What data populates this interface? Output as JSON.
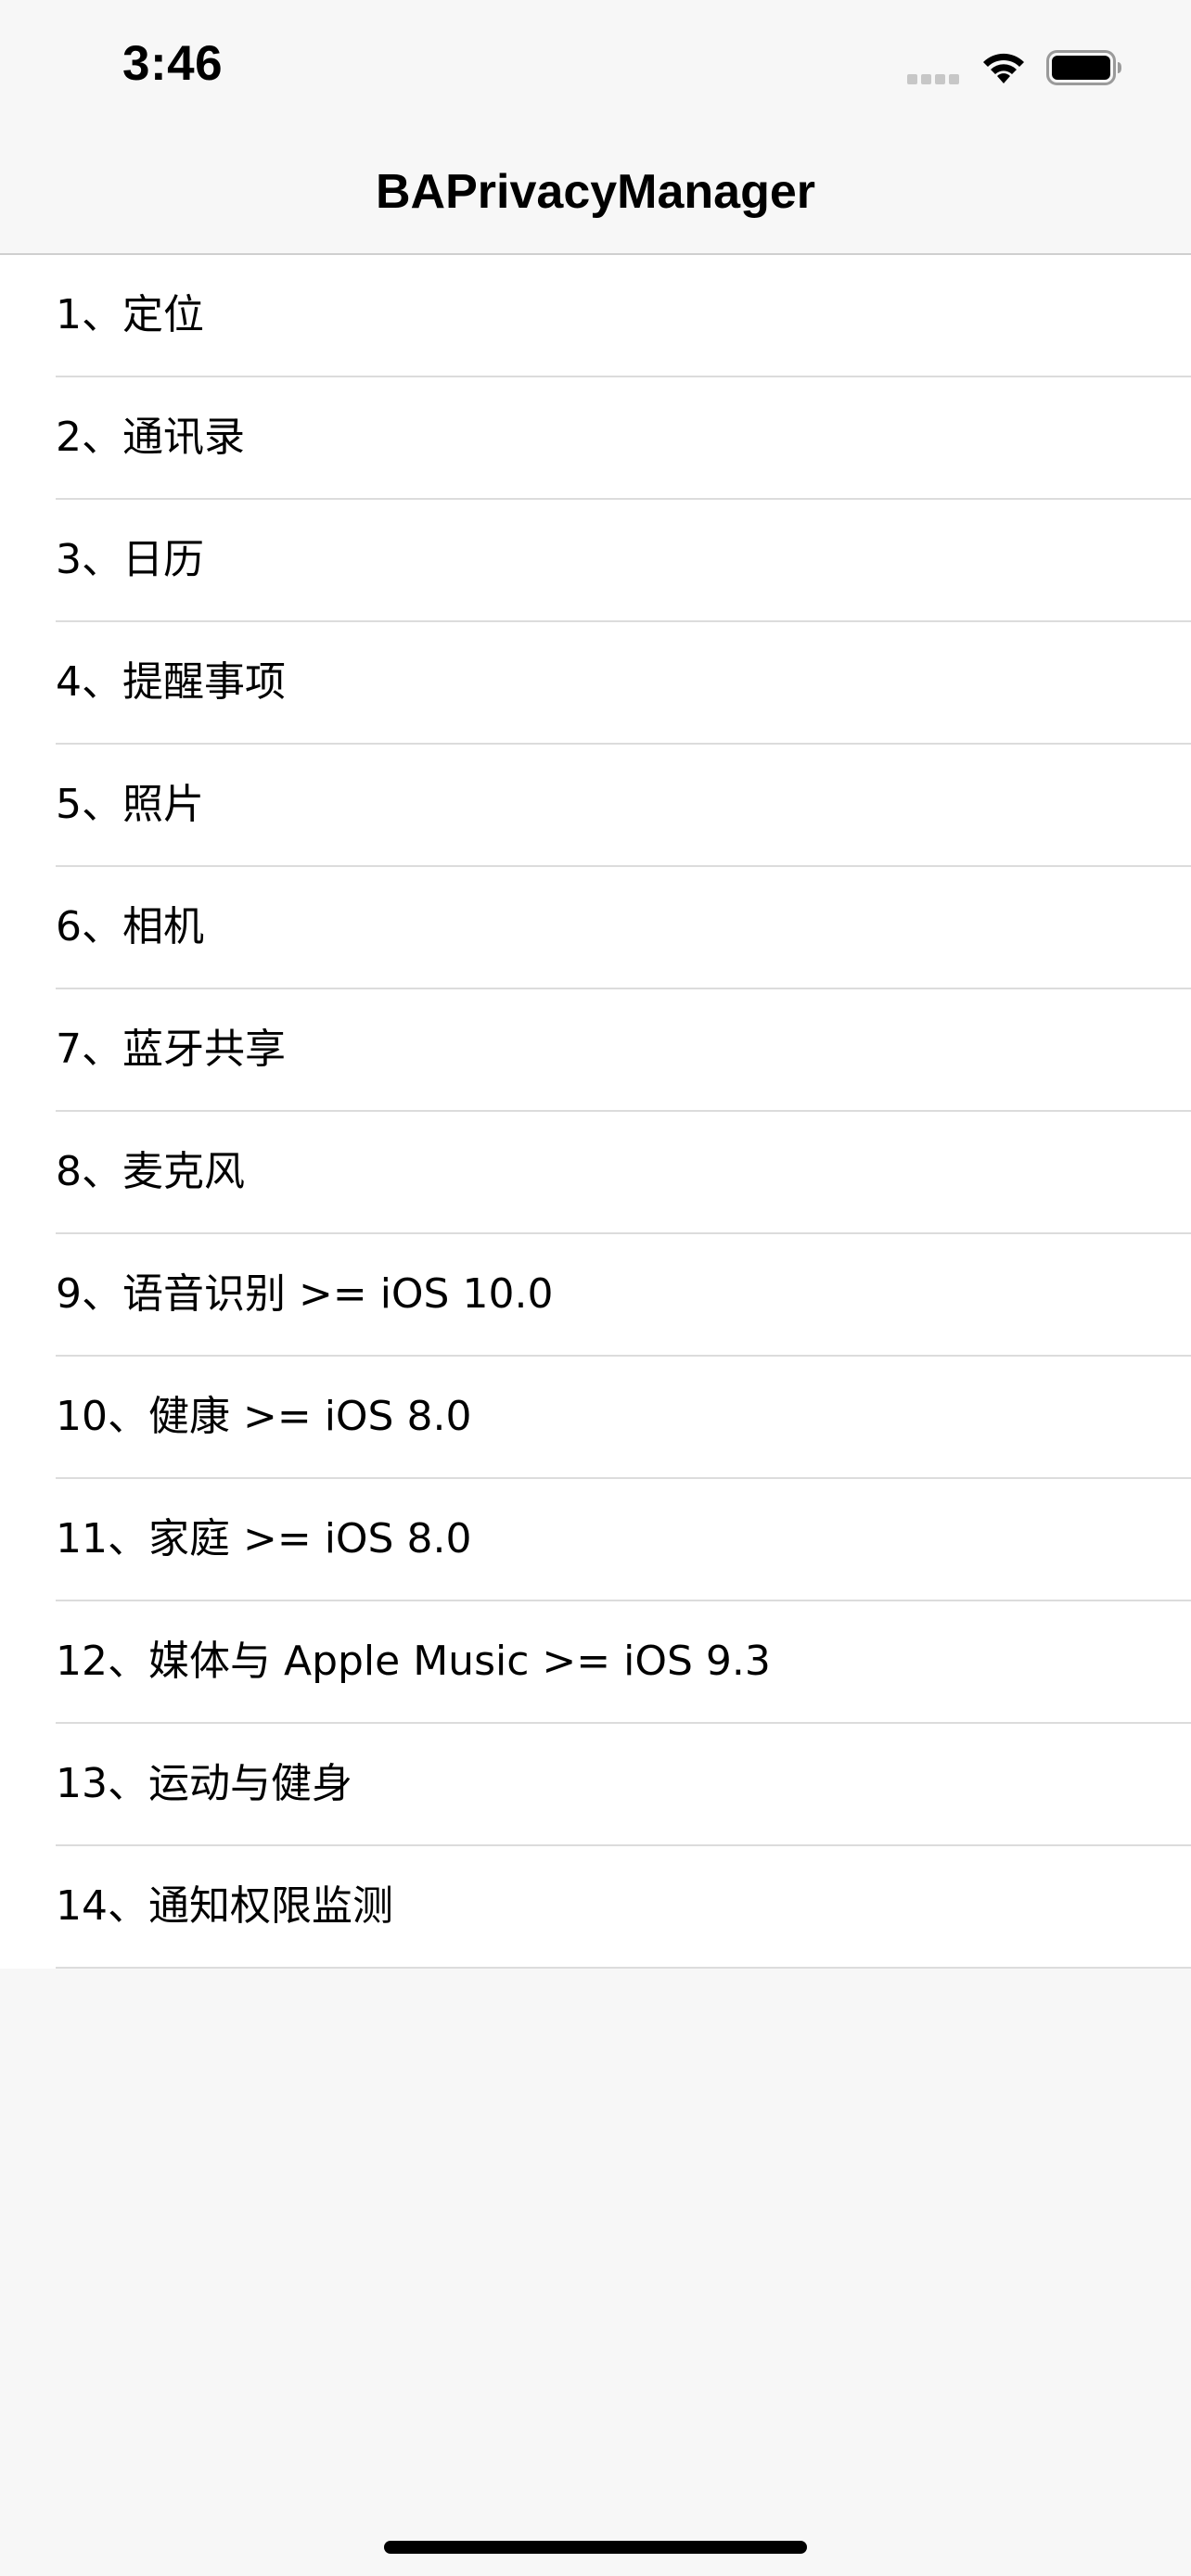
{
  "status_bar": {
    "time": "3:46"
  },
  "nav": {
    "title": "BAPrivacyManager"
  },
  "rows": [
    {
      "label": "1、定位"
    },
    {
      "label": "2、通讯录"
    },
    {
      "label": "3、日历"
    },
    {
      "label": "4、提醒事项"
    },
    {
      "label": "5、照片"
    },
    {
      "label": "6、相机"
    },
    {
      "label": "7、蓝牙共享"
    },
    {
      "label": "8、麦克风"
    },
    {
      "label": "9、语音识别 >= iOS 10.0"
    },
    {
      "label": "10、健康 >= iOS 8.0"
    },
    {
      "label": "11、家庭 >= iOS 8.0"
    },
    {
      "label": "12、媒体与 Apple Music >= iOS 9.3"
    },
    {
      "label": "13、运动与健身"
    },
    {
      "label": "14、通知权限监测"
    }
  ]
}
